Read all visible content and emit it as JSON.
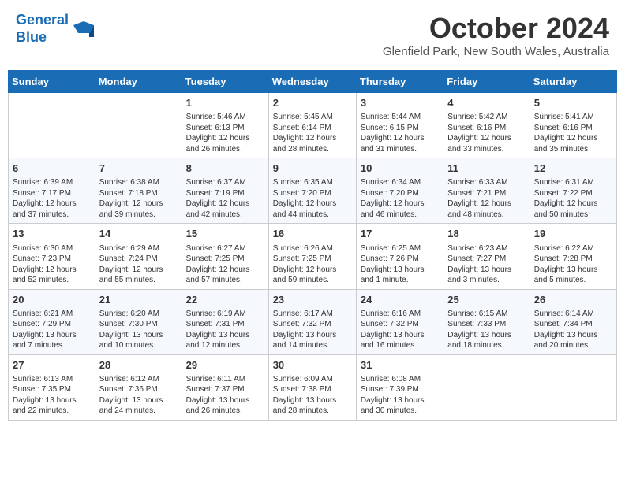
{
  "header": {
    "logo_line1": "General",
    "logo_line2": "Blue",
    "month_title": "October 2024",
    "subtitle": "Glenfield Park, New South Wales, Australia"
  },
  "days_of_week": [
    "Sunday",
    "Monday",
    "Tuesday",
    "Wednesday",
    "Thursday",
    "Friday",
    "Saturday"
  ],
  "weeks": [
    [
      {
        "day": "",
        "info": ""
      },
      {
        "day": "",
        "info": ""
      },
      {
        "day": "1",
        "info": "Sunrise: 5:46 AM\nSunset: 6:13 PM\nDaylight: 12 hours\nand 26 minutes."
      },
      {
        "day": "2",
        "info": "Sunrise: 5:45 AM\nSunset: 6:14 PM\nDaylight: 12 hours\nand 28 minutes."
      },
      {
        "day": "3",
        "info": "Sunrise: 5:44 AM\nSunset: 6:15 PM\nDaylight: 12 hours\nand 31 minutes."
      },
      {
        "day": "4",
        "info": "Sunrise: 5:42 AM\nSunset: 6:16 PM\nDaylight: 12 hours\nand 33 minutes."
      },
      {
        "day": "5",
        "info": "Sunrise: 5:41 AM\nSunset: 6:16 PM\nDaylight: 12 hours\nand 35 minutes."
      }
    ],
    [
      {
        "day": "6",
        "info": "Sunrise: 6:39 AM\nSunset: 7:17 PM\nDaylight: 12 hours\nand 37 minutes."
      },
      {
        "day": "7",
        "info": "Sunrise: 6:38 AM\nSunset: 7:18 PM\nDaylight: 12 hours\nand 39 minutes."
      },
      {
        "day": "8",
        "info": "Sunrise: 6:37 AM\nSunset: 7:19 PM\nDaylight: 12 hours\nand 42 minutes."
      },
      {
        "day": "9",
        "info": "Sunrise: 6:35 AM\nSunset: 7:20 PM\nDaylight: 12 hours\nand 44 minutes."
      },
      {
        "day": "10",
        "info": "Sunrise: 6:34 AM\nSunset: 7:20 PM\nDaylight: 12 hours\nand 46 minutes."
      },
      {
        "day": "11",
        "info": "Sunrise: 6:33 AM\nSunset: 7:21 PM\nDaylight: 12 hours\nand 48 minutes."
      },
      {
        "day": "12",
        "info": "Sunrise: 6:31 AM\nSunset: 7:22 PM\nDaylight: 12 hours\nand 50 minutes."
      }
    ],
    [
      {
        "day": "13",
        "info": "Sunrise: 6:30 AM\nSunset: 7:23 PM\nDaylight: 12 hours\nand 52 minutes."
      },
      {
        "day": "14",
        "info": "Sunrise: 6:29 AM\nSunset: 7:24 PM\nDaylight: 12 hours\nand 55 minutes."
      },
      {
        "day": "15",
        "info": "Sunrise: 6:27 AM\nSunset: 7:25 PM\nDaylight: 12 hours\nand 57 minutes."
      },
      {
        "day": "16",
        "info": "Sunrise: 6:26 AM\nSunset: 7:25 PM\nDaylight: 12 hours\nand 59 minutes."
      },
      {
        "day": "17",
        "info": "Sunrise: 6:25 AM\nSunset: 7:26 PM\nDaylight: 13 hours\nand 1 minute."
      },
      {
        "day": "18",
        "info": "Sunrise: 6:23 AM\nSunset: 7:27 PM\nDaylight: 13 hours\nand 3 minutes."
      },
      {
        "day": "19",
        "info": "Sunrise: 6:22 AM\nSunset: 7:28 PM\nDaylight: 13 hours\nand 5 minutes."
      }
    ],
    [
      {
        "day": "20",
        "info": "Sunrise: 6:21 AM\nSunset: 7:29 PM\nDaylight: 13 hours\nand 7 minutes."
      },
      {
        "day": "21",
        "info": "Sunrise: 6:20 AM\nSunset: 7:30 PM\nDaylight: 13 hours\nand 10 minutes."
      },
      {
        "day": "22",
        "info": "Sunrise: 6:19 AM\nSunset: 7:31 PM\nDaylight: 13 hours\nand 12 minutes."
      },
      {
        "day": "23",
        "info": "Sunrise: 6:17 AM\nSunset: 7:32 PM\nDaylight: 13 hours\nand 14 minutes."
      },
      {
        "day": "24",
        "info": "Sunrise: 6:16 AM\nSunset: 7:32 PM\nDaylight: 13 hours\nand 16 minutes."
      },
      {
        "day": "25",
        "info": "Sunrise: 6:15 AM\nSunset: 7:33 PM\nDaylight: 13 hours\nand 18 minutes."
      },
      {
        "day": "26",
        "info": "Sunrise: 6:14 AM\nSunset: 7:34 PM\nDaylight: 13 hours\nand 20 minutes."
      }
    ],
    [
      {
        "day": "27",
        "info": "Sunrise: 6:13 AM\nSunset: 7:35 PM\nDaylight: 13 hours\nand 22 minutes."
      },
      {
        "day": "28",
        "info": "Sunrise: 6:12 AM\nSunset: 7:36 PM\nDaylight: 13 hours\nand 24 minutes."
      },
      {
        "day": "29",
        "info": "Sunrise: 6:11 AM\nSunset: 7:37 PM\nDaylight: 13 hours\nand 26 minutes."
      },
      {
        "day": "30",
        "info": "Sunrise: 6:09 AM\nSunset: 7:38 PM\nDaylight: 13 hours\nand 28 minutes."
      },
      {
        "day": "31",
        "info": "Sunrise: 6:08 AM\nSunset: 7:39 PM\nDaylight: 13 hours\nand 30 minutes."
      },
      {
        "day": "",
        "info": ""
      },
      {
        "day": "",
        "info": ""
      }
    ]
  ]
}
